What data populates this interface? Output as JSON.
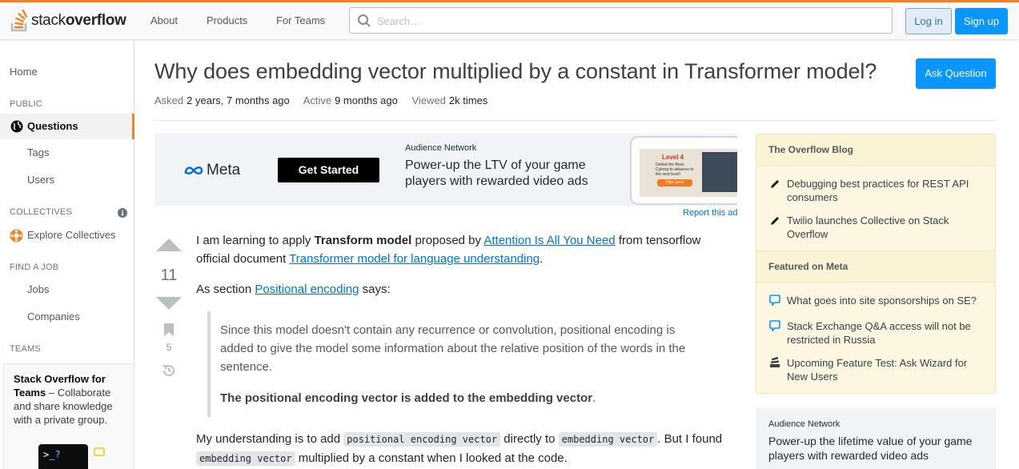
{
  "header": {
    "logo_prefix": "stack",
    "logo_suffix": "overflow",
    "nav": [
      "About",
      "Products",
      "For Teams"
    ],
    "search_placeholder": "Search…",
    "login_label": "Log in",
    "signup_label": "Sign up",
    "accent_color": "#f48225"
  },
  "sidebar": {
    "home": "Home",
    "public_heading": "PUBLIC",
    "questions": "Questions",
    "tags": "Tags",
    "users": "Users",
    "collectives_heading": "COLLECTIVES",
    "explore_collectives": "Explore Collectives",
    "find_job_heading": "FIND A JOB",
    "jobs": "Jobs",
    "companies": "Companies",
    "teams_heading": "TEAMS",
    "teams_title": "Stack Overflow for Teams",
    "teams_text": " – Collaborate and share knowledge with a private group.",
    "teams_prompt": ">_",
    "teams_q": "?"
  },
  "question": {
    "title": "Why does embedding vector multiplied by a constant in Transformer model?",
    "ask_button": "Ask Question",
    "asked_label": "Asked",
    "asked_value": "2 years, 7 months ago",
    "active_label": "Active",
    "active_value": "9 months ago",
    "viewed_label": "Viewed",
    "viewed_value": "2k times",
    "votes": "11",
    "bookmarks": "5"
  },
  "ad_banner": {
    "brand": "Meta",
    "cta": "Get Started",
    "network": "Audience Network",
    "headline": "Power-up the LTV of your game players with rewarded video ads",
    "level": "Level 4",
    "level_text": "Defeat the Boss Cyborg to advance to the next level!",
    "play": "Play Level",
    "report": "Report this ad"
  },
  "post": {
    "p1_a": "I am learning to apply ",
    "p1_b": "Transform model",
    "p1_c": " proposed by ",
    "p1_link1": "Attention Is All You Need",
    "p1_d": " from tensorflow official document ",
    "p1_link2": "Transformer model for language understanding",
    "p1_e": ".",
    "p2_a": "As section ",
    "p2_link": "Positional encoding",
    "p2_b": " says:",
    "quote1": "Since this model doesn't contain any recurrence or convolution, positional encoding is added to give the model some information about the relative position of the words in the sentence.",
    "quote2": "The positional encoding vector is added to the embedding vector",
    "quote2_end": ".",
    "p3_a": "My understanding is to add ",
    "p3_code1": "positional encoding vector",
    "p3_b": " directly to ",
    "p3_code2": "embedding vector",
    "p3_c": ". But I found ",
    "p3_code3": "embedding vector",
    "p3_d": " multiplied by a constant when I looked at the code."
  },
  "right_sidebar": {
    "blog_heading": "The Overflow Blog",
    "blog_items": [
      "Debugging best practices for REST API consumers",
      "Twilio launches Collective on Stack Overflow"
    ],
    "meta_heading": "Featured on Meta",
    "meta_items": [
      "What goes into site sponsorships on SE?",
      "Stack Exchange Q&A access will not be restricted in Russia",
      "Upcoming Feature Test: Ask Wizard for New Users"
    ],
    "ad_network": "Audience Network",
    "ad_headline": "Power-up the lifetime value of your game players with rewarded video ads"
  }
}
